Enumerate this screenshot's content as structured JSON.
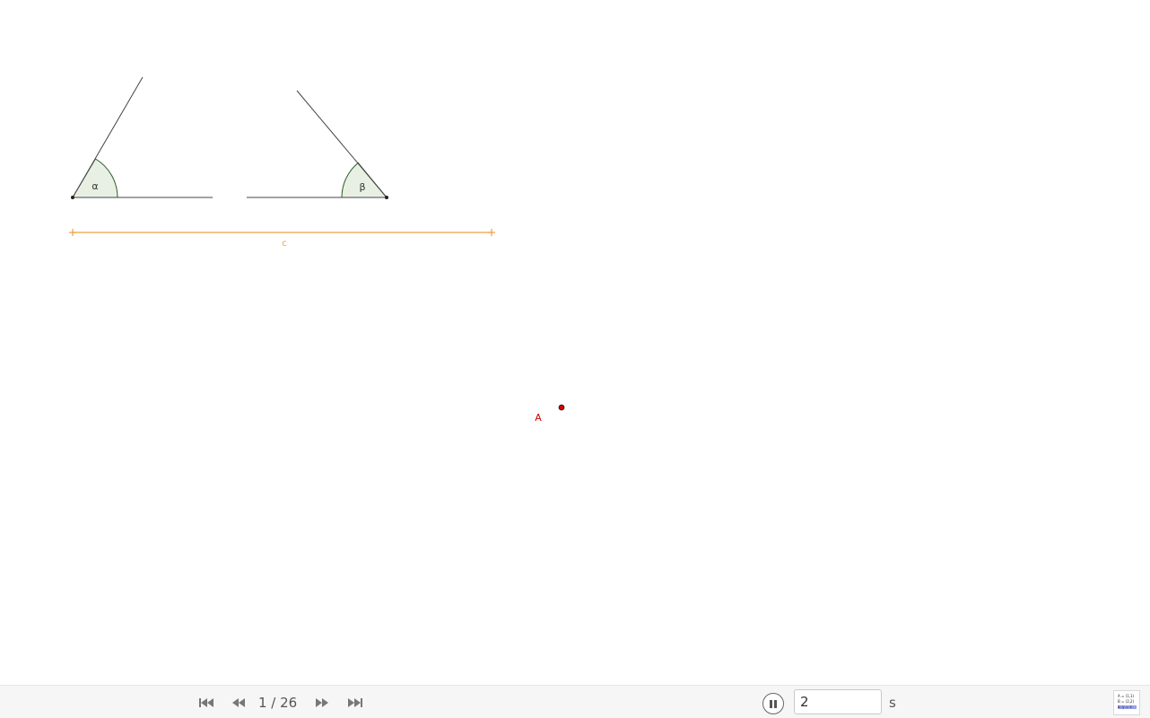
{
  "construction": {
    "angle_alpha_label": "α",
    "angle_beta_label": "β",
    "segment_label": "c",
    "point_label": "A",
    "colors": {
      "line": "#444444",
      "angle_fill": "#e8f0e4",
      "angle_stroke": "#2a5a2a",
      "segment": "#f0a040",
      "point": "#cc0000"
    }
  },
  "toolbar": {
    "first_icon": "skip-to-first-icon",
    "prev_icon": "rewind-icon",
    "step_text": "1 / 26",
    "next_icon": "fast-forward-icon",
    "last_icon": "skip-to-last-icon",
    "play_icon": "pause-icon",
    "speed_value": "2",
    "speed_unit": "s",
    "algebra_icon": "algebra-view-icon",
    "algebra_lines": [
      "A = (1,1)",
      "B = (2,2)",
      "a: y = x"
    ]
  }
}
